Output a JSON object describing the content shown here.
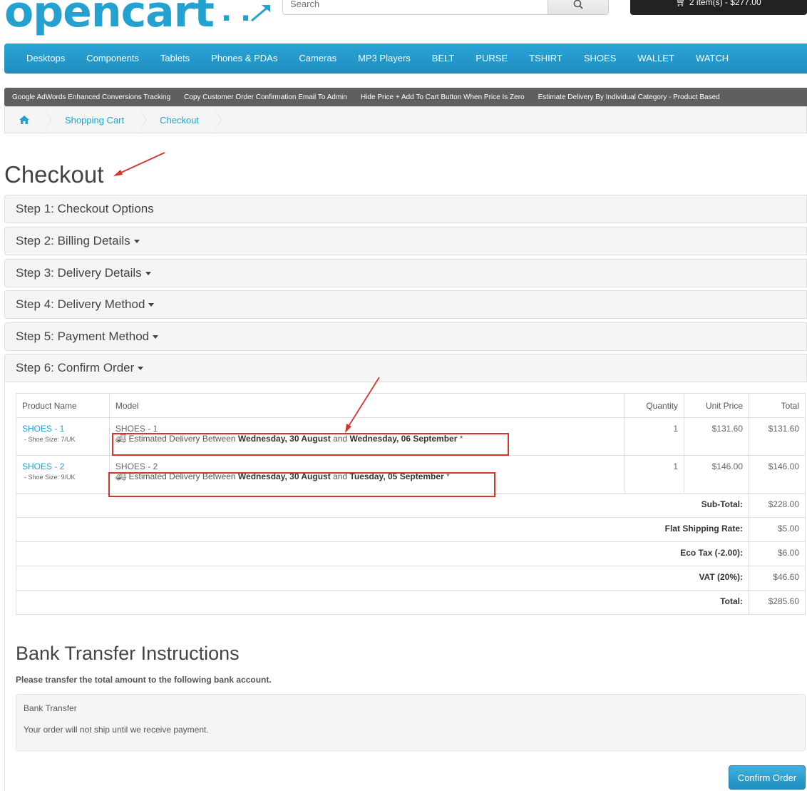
{
  "header": {
    "logo_text": "opencart",
    "search_placeholder": "Search",
    "cart_label": "2 item(s) - $277.00"
  },
  "menu": [
    "Desktops",
    "Components",
    "Tablets",
    "Phones & PDAs",
    "Cameras",
    "MP3 Players",
    "BELT",
    "PURSE",
    "TSHIRT",
    "SHOES",
    "WALLET",
    "WATCH"
  ],
  "extensions": [
    "Google AdWords Enhanced Conversions Tracking",
    "Copy Customer Order Confirmation Email To Admin",
    "Hide Price + Add To Cart Button When Price Is Zero",
    "Estimate Delivery By Individual Category - Product Based"
  ],
  "breadcrumb": [
    "Shopping Cart",
    "Checkout"
  ],
  "page_title": "Checkout",
  "steps": [
    "Step 1: Checkout Options",
    "Step 2: Billing Details",
    "Step 3: Delivery Details",
    "Step 4: Delivery Method",
    "Step 5: Payment Method",
    "Step 6: Confirm Order"
  ],
  "table": {
    "headers": [
      "Product Name",
      "Model",
      "Quantity",
      "Unit Price",
      "Total"
    ],
    "rows": [
      {
        "name": "SHOES - 1",
        "option": "- Shoe Size: 7/UK",
        "model": "SHOES - 1",
        "est_prefix": "Estimated Delivery Between",
        "date1": "Wednesday, 30 August",
        "and": "and",
        "date2": "Wednesday, 06 September",
        "star": "*",
        "qty": "1",
        "unit": "$131.60",
        "total": "$131.60"
      },
      {
        "name": "SHOES - 2",
        "option": "- Shoe Size: 9/UK",
        "model": "SHOES - 2",
        "est_prefix": "Estimated Delivery Between",
        "date1": "Wednesday, 30 August",
        "and": "and",
        "date2": "Tuesday, 05 September",
        "star": "*",
        "qty": "1",
        "unit": "$146.00",
        "total": "$146.00"
      }
    ],
    "totals": [
      {
        "label": "Sub-Total:",
        "value": "$228.00"
      },
      {
        "label": "Flat Shipping Rate:",
        "value": "$5.00"
      },
      {
        "label": "Eco Tax (-2.00):",
        "value": "$6.00"
      },
      {
        "label": "VAT (20%):",
        "value": "$46.60"
      },
      {
        "label": "Total:",
        "value": "$285.60"
      }
    ]
  },
  "bank": {
    "title": "Bank Transfer Instructions",
    "subtitle": "Please transfer the total amount to the following bank account.",
    "line1": "Bank Transfer",
    "line2": "Your order will not ship until we receive payment."
  },
  "confirm_label": "Confirm Order",
  "annotation_color": "#d9342b"
}
